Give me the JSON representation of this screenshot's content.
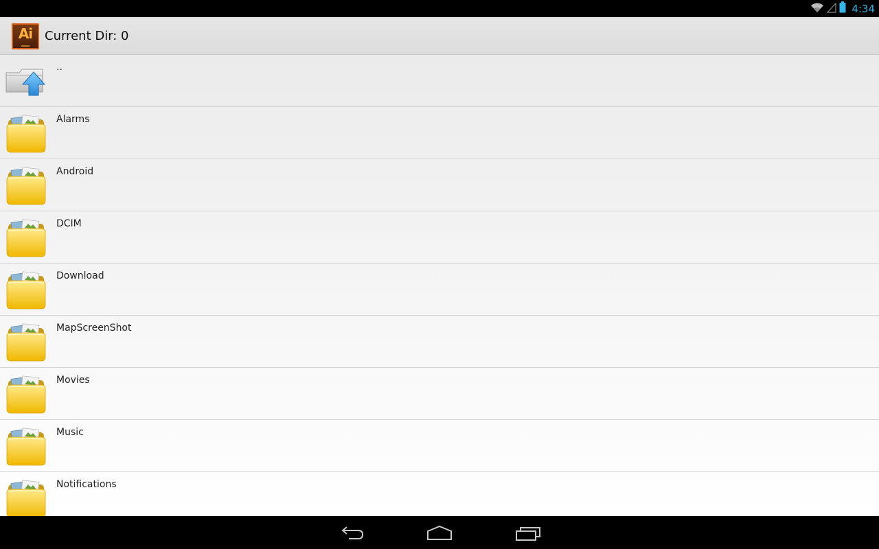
{
  "status_bar": {
    "time": "4:34",
    "icons": [
      "wifi-icon",
      "cell-signal-icon",
      "battery-icon"
    ],
    "accent_color": "#33b5e5"
  },
  "action_bar": {
    "app_icon_text": "Ai",
    "title": "Current Dir: 0"
  },
  "file_list": {
    "items": [
      {
        "label": "..",
        "icon": "parent-folder-up-icon"
      },
      {
        "label": "Alarms",
        "icon": "folder-icon"
      },
      {
        "label": "Android",
        "icon": "folder-icon"
      },
      {
        "label": "DCIM",
        "icon": "folder-icon"
      },
      {
        "label": "Download",
        "icon": "folder-icon"
      },
      {
        "label": "MapScreenShot",
        "icon": "folder-icon"
      },
      {
        "label": "Movies",
        "icon": "folder-icon"
      },
      {
        "label": "Music",
        "icon": "folder-icon"
      },
      {
        "label": "Notifications",
        "icon": "folder-icon"
      }
    ]
  },
  "nav_bar": {
    "buttons": [
      "back-icon",
      "home-icon",
      "recent-apps-icon"
    ]
  }
}
